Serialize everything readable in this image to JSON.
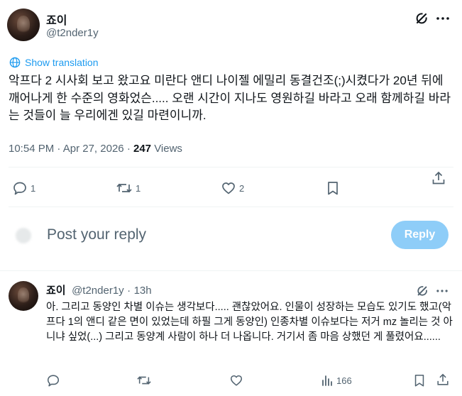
{
  "tweet": {
    "display_name": "죠이",
    "handle": "@t2nder1y",
    "translate_label": "Show translation",
    "text": "악프다 2 시사회 보고 왔고요 미란다 앤디 나이젤 에밀리 동결건조(;)시켰다가 20년 뒤에 깨어나게 한 수준의 영화었슨..... 오랜 시간이 지나도 영원하길 바라고 오래 함께하길 바라는 것들이 늘 우리에겐 있길 마련이니까.",
    "time": "10:54 PM",
    "dot": "·",
    "date": "Apr 27, 2026",
    "views_count": "247",
    "views_label": "Views",
    "replies": "1",
    "reposts": "1",
    "likes": "2"
  },
  "composer": {
    "placeholder": "Post your reply",
    "reply_button": "Reply"
  },
  "reply": {
    "display_name": "죠이",
    "handle": "@t2nder1y",
    "dot": "·",
    "age": "13h",
    "text": "아. 그리고 동양인 차별 이슈는 생각보다..... 괜찮았어요. 인물이 성장하는 모습도 있기도 했고(악프다 1의 앤디 같은 면이 있었는데 하필 그게 동양인) 인종차별 이슈보다는 저거 mz 놀리는 것 아니냐 싶었(...) 그리고 동양계 사람이 하나 더 나옵니다. 거기서 좀 마음 상했던 게 풀렸어요......",
    "views": "166"
  },
  "icons": {
    "grok": "grok-icon",
    "more": "more-icon",
    "reply": "reply-icon",
    "repost": "repost-icon",
    "like": "like-icon",
    "bookmark": "bookmark-icon",
    "share": "share-icon",
    "analytics": "analytics-icon",
    "translate": "translate-icon"
  },
  "colors": {
    "accent": "#1d9bf0",
    "text": "#0f1419",
    "muted": "#536471",
    "divider": "#eff3f4",
    "reply_button_bg": "#8ecdf8"
  }
}
